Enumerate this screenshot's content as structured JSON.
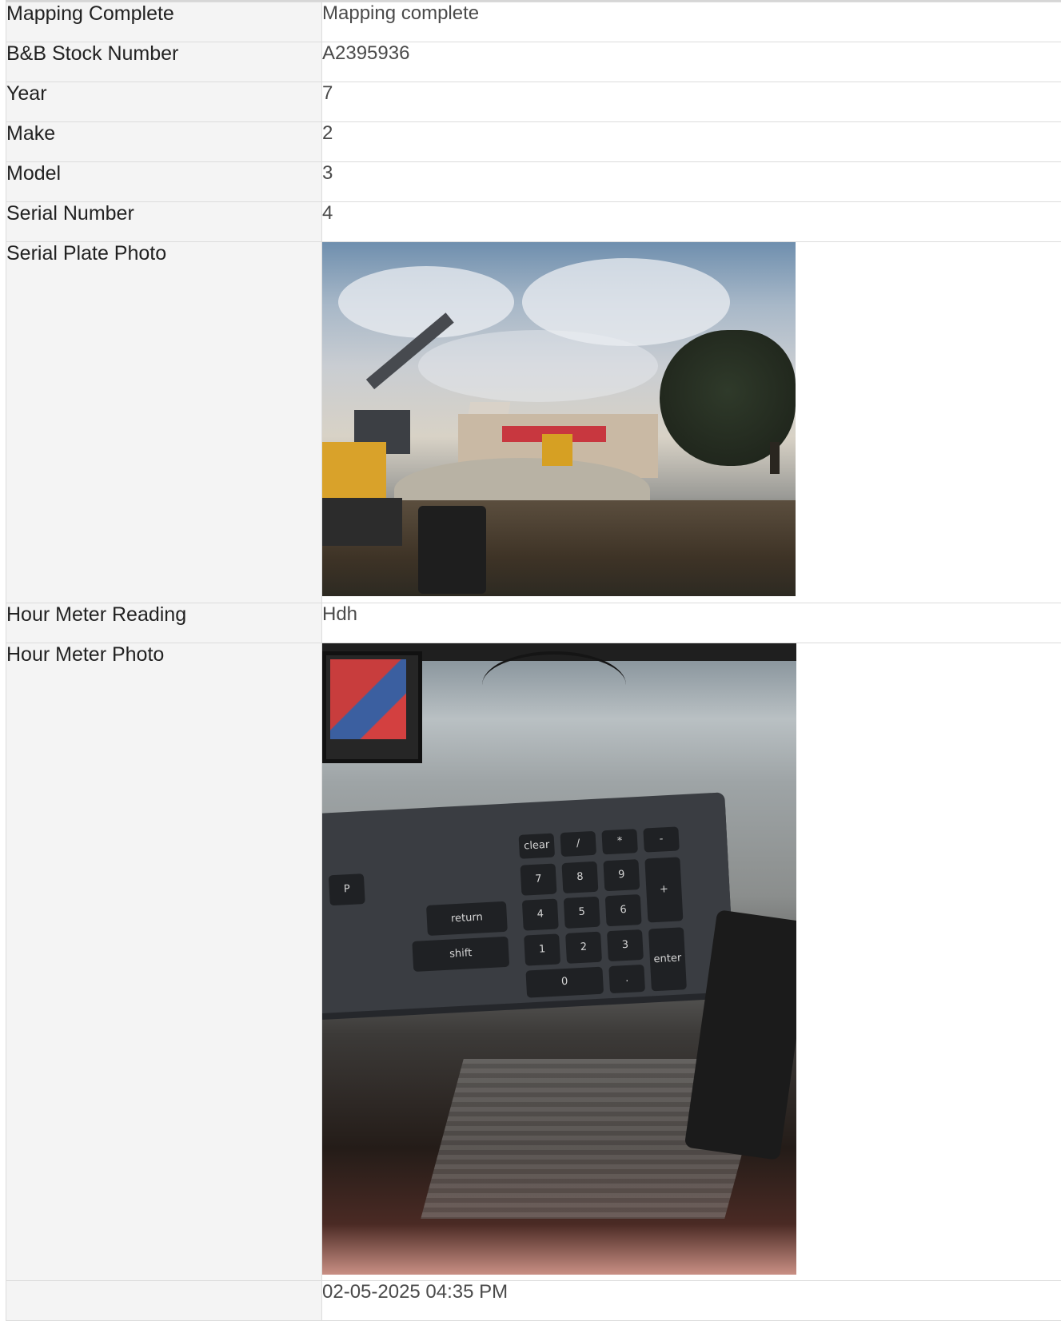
{
  "rows": [
    {
      "label": "Mapping Complete",
      "value": "Mapping complete"
    },
    {
      "label": "B&B Stock Number",
      "value": "A2395936"
    },
    {
      "label": "Year",
      "value": "7"
    },
    {
      "label": "Make",
      "value": "2"
    },
    {
      "label": "Model",
      "value": "3"
    },
    {
      "label": "Serial Number",
      "value": "4"
    }
  ],
  "serial_plate": {
    "label": "Serial Plate Photo"
  },
  "hour_meter": {
    "label": "Hour Meter Reading",
    "value": "Hdh"
  },
  "hour_meter_photo": {
    "label": "Hour Meter Photo"
  },
  "footer": {
    "label": "",
    "timestamp": "02-05-2025 04:35 PM"
  },
  "keyboard_keys": [
    "clear",
    "/",
    "*",
    "-",
    "7",
    "8",
    "9",
    "+",
    "4",
    "5",
    "6",
    "1",
    "2",
    "3",
    "0",
    ".",
    "enter",
    "return",
    "shift",
    "P"
  ]
}
